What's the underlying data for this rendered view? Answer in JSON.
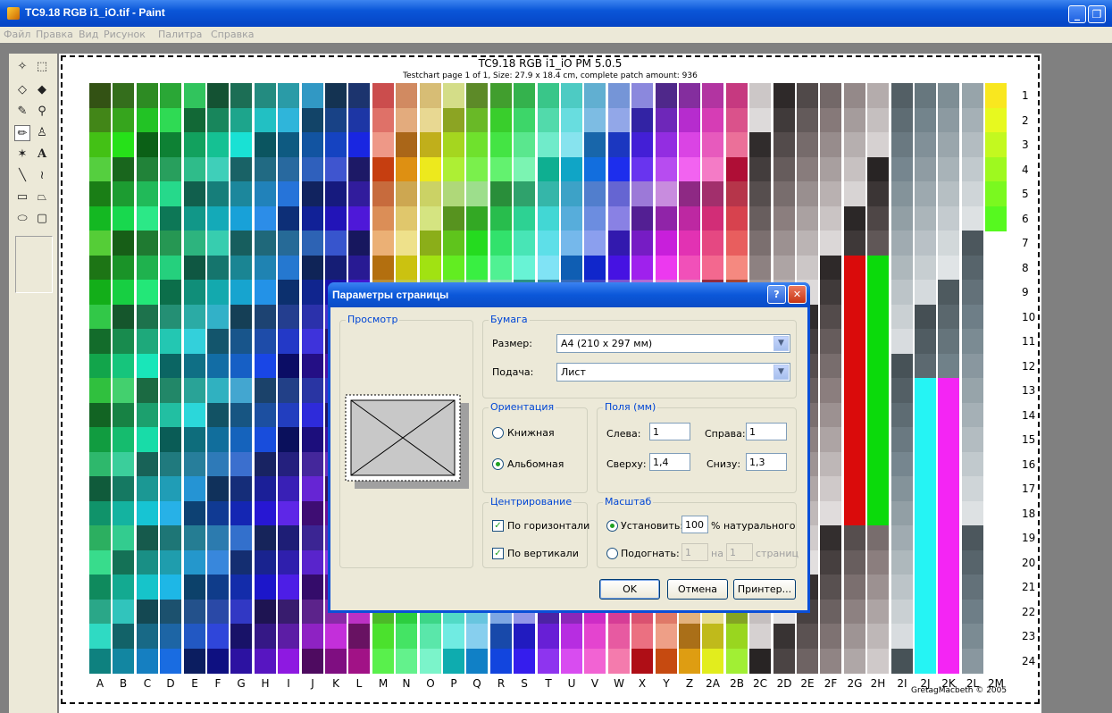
{
  "window": {
    "title": "TC9.18 RGB i1_iO.tif - Paint",
    "controls": [
      "_",
      "❐"
    ]
  },
  "menu": [
    "Файл",
    "Правка",
    "Вид",
    "Рисунок",
    "Палитра",
    "Справка"
  ],
  "toolbox": {
    "tools": [
      "free-select",
      "rect-select",
      "eraser",
      "fill",
      "color-picker",
      "magnifier",
      "pencil",
      "brush",
      "airbrush",
      "text",
      "line",
      "curve",
      "rectangle",
      "polygon",
      "ellipse",
      "rounded-rectangle"
    ],
    "active": "pencil"
  },
  "canvas": {
    "title": "TC9.18 RGB i1_iO PM 5.0.5",
    "subtitle": "Testchart page 1 of 1, Size: 27.9 x 18.4 cm, complete patch amount: 936",
    "copyright": "GretagMacbeth © 2005",
    "columns": [
      "A",
      "B",
      "C",
      "D",
      "E",
      "F",
      "G",
      "H",
      "I",
      "J",
      "K",
      "L",
      "M",
      "N",
      "O",
      "P",
      "Q",
      "R",
      "S",
      "T",
      "U",
      "V",
      "W",
      "X",
      "Y",
      "Z",
      "2A",
      "2B",
      "2C",
      "2D",
      "2E",
      "2F",
      "2G",
      "2H",
      "2I",
      "2J",
      "2K",
      "2L",
      "2M"
    ],
    "rows": [
      "1",
      "2",
      "3",
      "4",
      "5",
      "6",
      "7",
      "8",
      "9",
      "10",
      "11",
      "12",
      "13",
      "14",
      "15",
      "16",
      "17",
      "18",
      "19",
      "20",
      "21",
      "22",
      "23",
      "24"
    ]
  },
  "dialog": {
    "title": "Параметры страницы",
    "help_label": "?",
    "close_label": "✕",
    "preview_legend": "Просмотр",
    "paper": {
      "legend": "Бумага",
      "size_label": "Размер:",
      "size_value": "A4 (210 x 297 мм)",
      "source_label": "Подача:",
      "source_value": "Лист"
    },
    "orientation": {
      "legend": "Ориентация",
      "portrait": "Книжная",
      "landscape": "Альбомная",
      "selected": "landscape"
    },
    "margins": {
      "legend": "Поля (мм)",
      "left_label": "Слева:",
      "left_value": "1",
      "right_label": "Справа:",
      "right_value": "1",
      "top_label": "Сверху:",
      "top_value": "1,4",
      "bottom_label": "Снизу:",
      "bottom_value": "1,3"
    },
    "centering": {
      "legend": "Центрирование",
      "horizontal": "По горизонтали",
      "vertical": "По вертикали",
      "horizontal_checked": true,
      "vertical_checked": true
    },
    "scale": {
      "legend": "Масштаб",
      "adjust_label": "Установить:",
      "adjust_value": "100",
      "adjust_suffix": "% натурального",
      "fit_label": "Подогнать:",
      "fit_wide": "1",
      "fit_by": "на",
      "fit_tall": "1",
      "fit_suffix": "страниц"
    },
    "buttons": {
      "ok": "OK",
      "cancel": "Отмена",
      "printer": "Принтер..."
    }
  },
  "colors": {
    "titlebar": "#0a56d8",
    "dialog_face": "#ece9d8",
    "group_title": "#0046d5",
    "workspace": "#808080"
  }
}
